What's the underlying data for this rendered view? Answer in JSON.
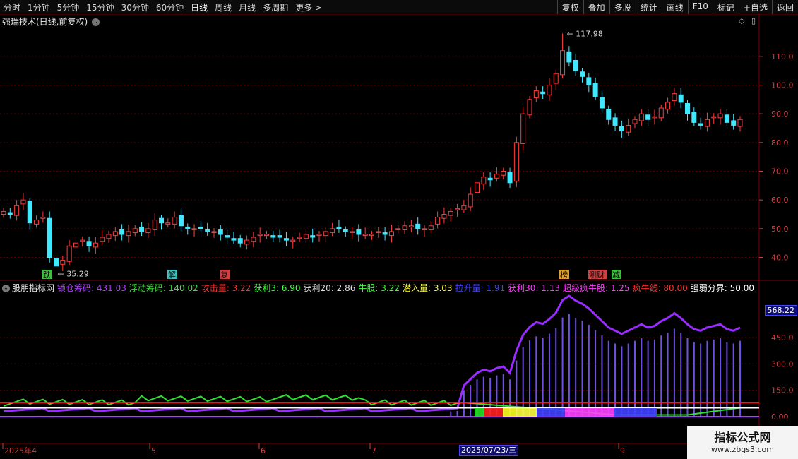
{
  "toolbar": {
    "left": [
      "分时",
      "1分钟",
      "5分钟",
      "15分钟",
      "30分钟",
      "60分钟",
      "日线",
      "周线",
      "月线",
      "多周期",
      "更多 >"
    ],
    "active": "日线",
    "right": [
      "复权",
      "叠加",
      "多股",
      "统计",
      "画线",
      "F10",
      "标记",
      "+自选",
      "返回"
    ]
  },
  "main_chart": {
    "title": "强瑞技术(日线,前复权)",
    "high_label": "117.98",
    "low_label": "35.29",
    "y_ticks": [
      "110.0",
      "100.0",
      "90.0",
      "80.0",
      "70.0",
      "60.0",
      "50.0",
      "40.0"
    ],
    "markers": [
      {
        "text": "跌",
        "color": "#40c040"
      },
      {
        "text": "解",
        "color": "#40c0c0"
      },
      {
        "text": "复",
        "color": "#d04040"
      },
      {
        "text": "榜",
        "color": "#e0a030"
      },
      {
        "text": "测财",
        "color": "#d04040"
      },
      {
        "text": "减",
        "color": "#40c040"
      }
    ]
  },
  "indicator": {
    "name": "股朋指标网",
    "values": [
      {
        "label": "锁仓筹码:",
        "value": "431.03",
        "color": "#b040ff"
      },
      {
        "label": "浮动筹码:",
        "value": "140.02",
        "color": "#40e040"
      },
      {
        "label": "攻击量:",
        "value": "3.22",
        "color": "#ff3030"
      },
      {
        "label": "获利3:",
        "value": "6.90",
        "color": "#40ff40"
      },
      {
        "label": "获利20:",
        "value": "2.86",
        "color": "#e0e0e0"
      },
      {
        "label": "牛股:",
        "value": "3.22",
        "color": "#40ff40"
      },
      {
        "label": "潜入量:",
        "value": "3.03",
        "color": "#ffff40"
      },
      {
        "label": "拉升量:",
        "value": "1.91",
        "color": "#4040ff"
      },
      {
        "label": "获利30:",
        "value": "1.13",
        "color": "#ff40ff"
      },
      {
        "label": "超级疯牛股:",
        "value": "1.25",
        "color": "#ff40ff"
      },
      {
        "label": "疯牛线:",
        "value": "80.00",
        "color": "#ff3030"
      },
      {
        "label": "强弱分界:",
        "value": "50.00",
        "color": "#ffffff"
      }
    ],
    "y_ticks": [
      "450.0",
      "300.0",
      "150.0",
      "0.00"
    ],
    "current_value": "568.22"
  },
  "date_axis": {
    "labels": [
      "2025年4",
      "5",
      "6",
      "7",
      "9"
    ],
    "current": "2025/07/23/三"
  },
  "watermark": {
    "line1": "指标公式网",
    "line2": "www.zbgs3.com"
  },
  "colors": {
    "up": "#ff3c3c",
    "down": "#40e8ff",
    "grid": "#5a0000",
    "axis": "#d04040"
  },
  "chart_data": {
    "type": "candlestick",
    "ylim": [
      33,
      122
    ],
    "closes": [
      56,
      55,
      58,
      60,
      52,
      53,
      54,
      40,
      37,
      39,
      44,
      45,
      46,
      44,
      45,
      47,
      48,
      49,
      48,
      49,
      50,
      49,
      50,
      53,
      52,
      52,
      54,
      51,
      50,
      50,
      50,
      49,
      49,
      48,
      47,
      46,
      45,
      46,
      47,
      48,
      48,
      47,
      47,
      46,
      46,
      47,
      48,
      47,
      48,
      49,
      50,
      50,
      49,
      49,
      48,
      48,
      48,
      49,
      48,
      49,
      50,
      51,
      51,
      50,
      50,
      51,
      54,
      55,
      56,
      57,
      58,
      62,
      66,
      68,
      67,
      69,
      70,
      66,
      80,
      90,
      95,
      98,
      97,
      100,
      104,
      112,
      108,
      105,
      103,
      100,
      96,
      92,
      88,
      86,
      84,
      86,
      88,
      90,
      88,
      89,
      92,
      94,
      97,
      94,
      90,
      87,
      86,
      88,
      89,
      90,
      87,
      86,
      88
    ]
  }
}
